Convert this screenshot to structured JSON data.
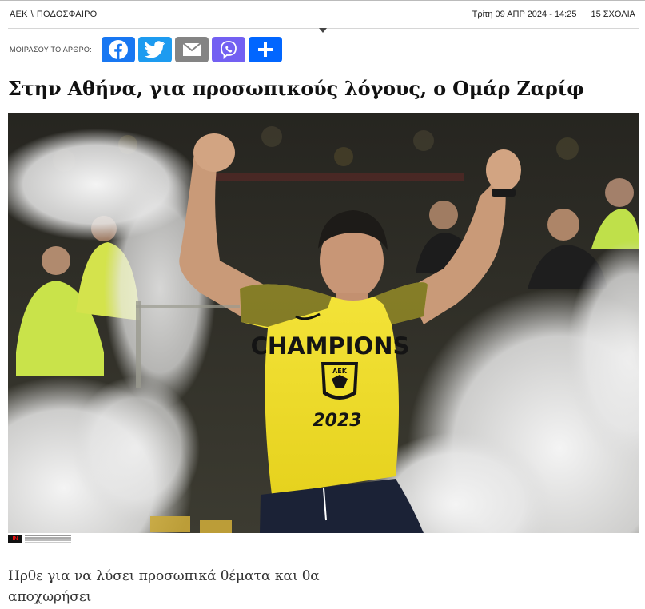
{
  "breadcrumb": {
    "section": "ΑΕΚ",
    "separator": "\\",
    "subsection": "ΠΟΔΟΣΦΑΙΡΟ"
  },
  "meta": {
    "date": "Τρίτη 09 ΑΠΡ 2024 - 14:25",
    "comments": "15 ΣΧΟΛΙΑ"
  },
  "share": {
    "label": "ΜΟΙΡΑΣΟΥ ΤΟ ΑΡΘΡΟ:",
    "buttons": [
      {
        "icon": "facebook-icon",
        "color": "#1877f2"
      },
      {
        "icon": "twitter-icon",
        "color": "#1d9bf0"
      },
      {
        "icon": "email-icon",
        "color": "#848484"
      },
      {
        "icon": "viber-icon",
        "color": "#7360f2"
      },
      {
        "icon": "plus-icon",
        "color": "#0166ff"
      }
    ]
  },
  "article": {
    "title": "Στην Αθήνα, για προσωπικούς λόγους, ο Ομάρ Ζαρίφ",
    "lead": "Ηρθε για να λύσει προσωπικά θέματα και θα αποχωρήσει"
  },
  "photo": {
    "shirt_text": "CHAMPIONS",
    "crest_text": "ΑΕΚ",
    "year": "2023",
    "credit_badge": "IN"
  }
}
